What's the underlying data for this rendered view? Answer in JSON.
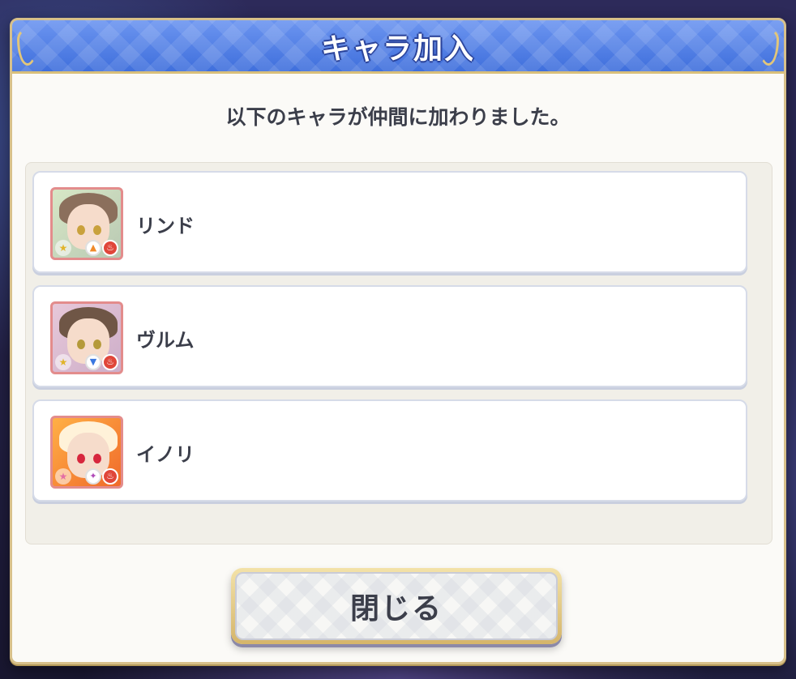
{
  "dialog": {
    "title": "キャラ加入",
    "message": "以下のキャラが仲間に加わりました。",
    "characters": [
      {
        "name": "リンド",
        "star_icon": "star-icon",
        "type_icon": "arrow-up-icon",
        "element_icon": "fire-icon"
      },
      {
        "name": "ヴルム",
        "star_icon": "star-icon",
        "type_icon": "arrow-down-icon",
        "element_icon": "fire-icon"
      },
      {
        "name": "イノリ",
        "star_icon": "star-icon",
        "type_icon": "wand-icon",
        "element_icon": "fire-icon"
      }
    ],
    "close_label": "閉じる"
  },
  "colors": {
    "title_bar": "#4f7fe6",
    "frame_gold": "#d7c08a",
    "text": "#3b3e4a",
    "element_fire": "#e0463a"
  }
}
